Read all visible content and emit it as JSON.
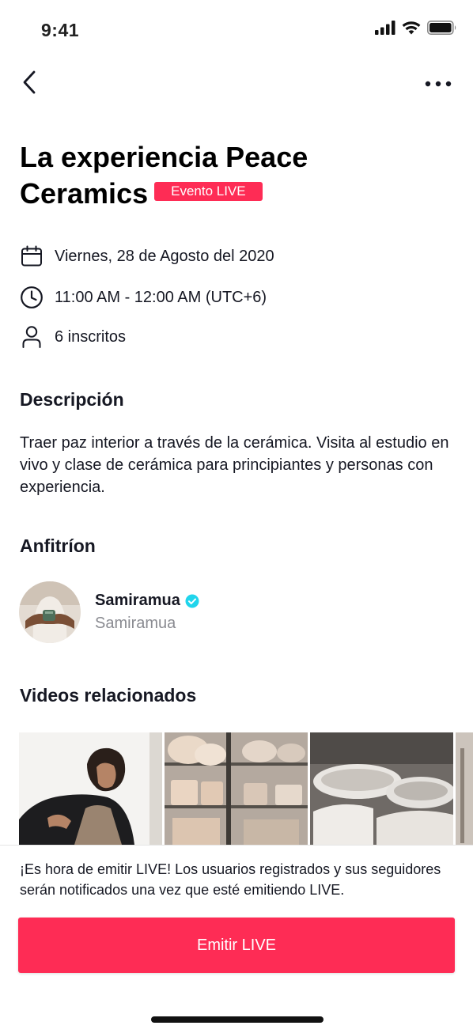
{
  "status_bar": {
    "time": "9:41"
  },
  "event": {
    "title": "La experiencia Peace Ceramics",
    "badge": "Evento LIVE",
    "date": "Viernes, 28 de Agosto del 2020",
    "time_range": "11:00 AM - 12:00 AM (UTC+6)",
    "registered": "6 inscritos"
  },
  "description": {
    "heading": "Descripción",
    "text": "Traer paz interior a través de la cerámica. Visita al estudio en vivo y clase de cerámica para principiantes y personas con experiencia."
  },
  "host": {
    "heading": "Anfitríon",
    "name": "Samiramua",
    "handle": "Samiramua"
  },
  "videos": {
    "heading": "Videos relacionados"
  },
  "footer": {
    "notice": "¡Es hora de emitir LIVE! Los usuarios registrados y sus seguidores serán notificados una vez que esté emitiendo LIVE.",
    "button_label": "Emitir LIVE"
  },
  "colors": {
    "accent": "#fe2c55",
    "verified": "#20d5ec",
    "secondary_text": "#8a8b91"
  },
  "icons": {
    "back": "chevron-left-icon",
    "more": "ellipsis-icon",
    "date": "calendar-icon",
    "time": "clock-icon",
    "registered": "person-icon",
    "verified": "verified-badge-icon"
  }
}
